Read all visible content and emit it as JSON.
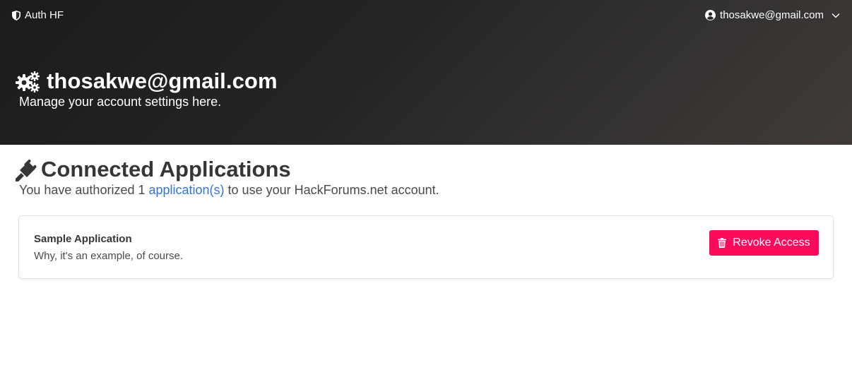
{
  "navbar": {
    "brand": "Auth HF",
    "brand_icon": "shield-icon",
    "user_email": "thosakwe@gmail.com",
    "user_icon": "user-circle-icon",
    "dropdown_icon": "chevron-down-icon"
  },
  "hero": {
    "icon": "cogs-icon",
    "title": "thosakwe@gmail.com",
    "subtitle": "Manage your account settings here."
  },
  "connected": {
    "icon": "plug-icon",
    "title": "Connected Applications",
    "sub_prefix": "You have authorized 1",
    "sub_link": "application(s)",
    "sub_suffix": " to use your HackForums.net account.",
    "applications": [
      {
        "name": "Sample Application",
        "description": "Why, it's an example, of course.",
        "revoke_label": "Revoke Access",
        "revoke_icon": "trash-icon"
      }
    ]
  },
  "colors": {
    "accent_danger": "#ff0a5a",
    "link": "#3273dc",
    "hero_dark": "#1c1b1c"
  }
}
